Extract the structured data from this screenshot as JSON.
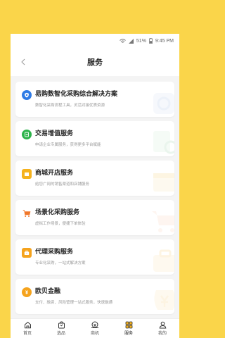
{
  "status_bar": {
    "battery": "51%",
    "time": "9:45 PM"
  },
  "header": {
    "title": "服务"
  },
  "services": [
    {
      "title": "易购数智化采购综合解决方案",
      "desc": "数智化采购流程工具，灵活对接优质资源",
      "icon": "shield-icon",
      "color": "#2f7be5"
    },
    {
      "title": "交易增值服务",
      "desc": "申请企业专属服务，获得更多平台赋能",
      "icon": "chart-doc-icon",
      "color": "#2cb34a"
    },
    {
      "title": "商城开店服务",
      "desc": "给您广阔的销售渠道和店铺服务",
      "icon": "shop-icon",
      "color": "#f5b21d"
    },
    {
      "title": "场景化采购服务",
      "desc": "虚拟工作场景，便捷下单体验",
      "icon": "cart-icon",
      "color": "#f0772a"
    },
    {
      "title": "代理采购服务",
      "desc": "专业化采购，一站式解决方案",
      "icon": "briefcase-icon",
      "color": "#f5a31d"
    },
    {
      "title": "欧贝金融",
      "desc": "支付、融资、风险管理一站式服务，快速融通",
      "icon": "finance-icon",
      "color": "#f5a31d"
    }
  ],
  "tabs": [
    {
      "label": "首页",
      "icon": "home-icon"
    },
    {
      "label": "选品",
      "icon": "bag-icon"
    },
    {
      "label": "商机",
      "icon": "opportunity-icon"
    },
    {
      "label": "服务",
      "icon": "grid-icon",
      "active": true
    },
    {
      "label": "我的",
      "icon": "user-icon"
    }
  ]
}
